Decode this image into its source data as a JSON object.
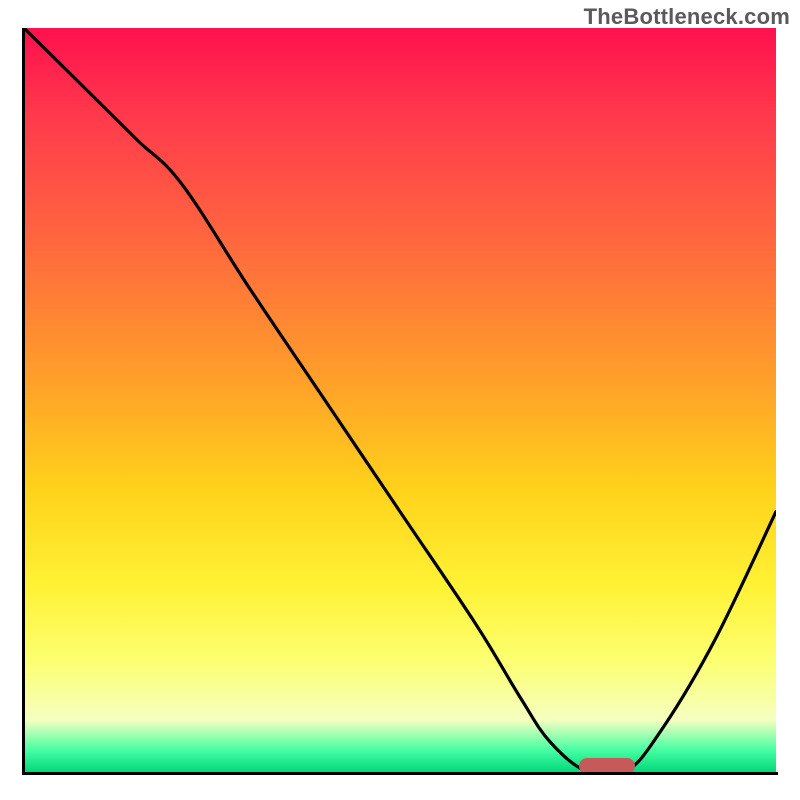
{
  "watermark": "TheBottleneck.com",
  "colors": {
    "gradient_top": "#ff104e",
    "gradient_bottom": "#00d97a",
    "curve": "#000000",
    "marker": "#c65a5a",
    "axis": "#000000"
  },
  "chart_data": {
    "type": "line",
    "title": "",
    "xlabel": "",
    "ylabel": "",
    "xlim": [
      0,
      100
    ],
    "ylim": [
      0,
      100
    ],
    "grid": false,
    "legend": false,
    "series": [
      {
        "name": "bottleneck-curve",
        "x": [
          0,
          8,
          15,
          21,
          30,
          40,
          50,
          60,
          66,
          70,
          75,
          80,
          85,
          92,
          100
        ],
        "y": [
          100,
          92,
          85,
          79,
          65,
          50,
          35,
          20,
          10,
          4,
          0,
          0,
          6,
          18,
          35
        ]
      }
    ],
    "marker": {
      "x": 77.5,
      "y": 0,
      "label": "optimal-range"
    },
    "background_gradient": {
      "stops": [
        {
          "pos": 0.0,
          "color": "#ff104e"
        },
        {
          "pos": 0.12,
          "color": "#ff3a4c"
        },
        {
          "pos": 0.3,
          "color": "#ff6b3d"
        },
        {
          "pos": 0.48,
          "color": "#ffa229"
        },
        {
          "pos": 0.62,
          "color": "#ffd21a"
        },
        {
          "pos": 0.75,
          "color": "#fff235"
        },
        {
          "pos": 0.85,
          "color": "#fcff70"
        },
        {
          "pos": 0.93,
          "color": "#f5ffc0"
        },
        {
          "pos": 0.97,
          "color": "#48ffa4"
        },
        {
          "pos": 1.0,
          "color": "#00d97a"
        }
      ]
    }
  }
}
